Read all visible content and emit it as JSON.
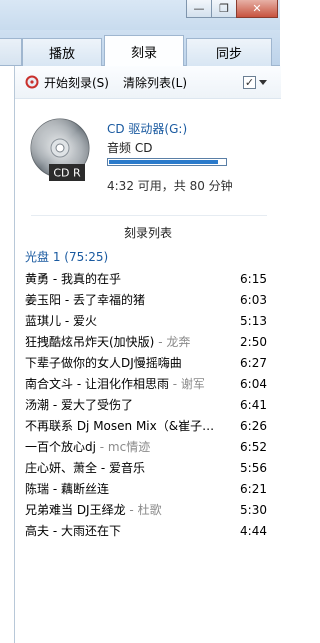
{
  "window": {
    "minimize_glyph": "—",
    "restore_glyph": "❐",
    "close_glyph": "✕"
  },
  "tabs": [
    {
      "label": "播放",
      "active": false
    },
    {
      "label": "刻录",
      "active": true
    },
    {
      "label": "同步",
      "active": false
    }
  ],
  "toolbar": {
    "start_burn": "开始刻录(S)",
    "clear_list": "清除列表(L)",
    "options_check": "✓"
  },
  "disc": {
    "drive": "CD 驱动器(G:)",
    "type": "音频 CD",
    "label_on_icon": "CD R",
    "capacity": "4:32 可用，共 80 分钟",
    "used_fraction": 0.94
  },
  "list": {
    "heading": "刻录列表",
    "disc_header": "光盘 1 (75:25)",
    "tracks": [
      {
        "title": "黄勇 - 我真的在乎",
        "artist": "",
        "duration": "6:15"
      },
      {
        "title": "姜玉阳 - 丢了幸福的猪",
        "artist": "",
        "duration": "6:03"
      },
      {
        "title": "蓝琪儿 - 爱火",
        "artist": "",
        "duration": "5:13"
      },
      {
        "title": "狂拽酷炫吊炸天(加快版)",
        "artist": " - 龙奔",
        "duration": "2:50"
      },
      {
        "title": "下辈子做你的女人DJ慢摇嗨曲",
        "artist": "",
        "duration": "6:27"
      },
      {
        "title": "南合文斗 - 让泪化作相思雨",
        "artist": " - 谢军",
        "duration": "6:04"
      },
      {
        "title": "汤潮 - 爱大了受伤了",
        "artist": "",
        "duration": "6:41"
      },
      {
        "title": "不再联系 Dj Mosen Mix（&崔子…",
        "artist": "",
        "duration": "6:26"
      },
      {
        "title": "一百个放心dj",
        "artist": " - mc情迹",
        "duration": "6:52"
      },
      {
        "title": "庄心妍、萧全 - 爱音乐",
        "artist": "",
        "duration": "5:56"
      },
      {
        "title": "陈瑞 - 藕断丝连",
        "artist": "",
        "duration": "6:21"
      },
      {
        "title": "兄弟难当 DJ王绎龙",
        "artist": " - 杜歌",
        "duration": "5:30"
      },
      {
        "title": "高夫 - 大雨还在下",
        "artist": "",
        "duration": "4:44"
      }
    ]
  },
  "colors": {
    "accent": "#1a5aa0",
    "progress": "#2a7acb"
  }
}
